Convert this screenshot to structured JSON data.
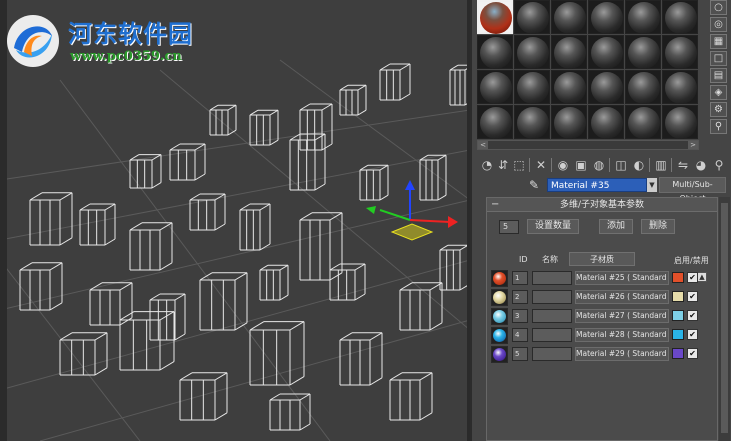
{
  "watermark": {
    "title": "河东软件园",
    "url": "www.pc0359.cn",
    "logo_icon": "blue-swirl-logo"
  },
  "panel": {
    "active_material_name": "Material #35",
    "material_type": "Multi/Sub-Object",
    "rollout": {
      "title": "多维/子对象基本参数",
      "count": "5",
      "set_count_label": "设置数量",
      "add_label": "添加",
      "delete_label": "删除",
      "col_id": "ID",
      "col_name": "名称",
      "col_submaterial": "子材质",
      "col_onoff": "启用/禁用",
      "rows": [
        {
          "id": "1",
          "material": "Material #25  ( Standard )",
          "color": "#e2502a",
          "ball": "#c03818",
          "checked": true
        },
        {
          "id": "2",
          "material": "Material #26  ( Standard )",
          "color": "#e6dcaa",
          "ball": "#b8aa70",
          "checked": true
        },
        {
          "id": "3",
          "material": "Material #27  ( Standard )",
          "color": "#7ecfe6",
          "ball": "#4aa8c8",
          "checked": true
        },
        {
          "id": "4",
          "material": "Material #28  ( Standard )",
          "color": "#2ab4e8",
          "ball": "#1a7ec0",
          "checked": true
        },
        {
          "id": "5",
          "material": "Material #29  ( Standard )",
          "color": "#6a48c8",
          "ball": "#4a2aa0",
          "checked": true
        }
      ]
    }
  }
}
